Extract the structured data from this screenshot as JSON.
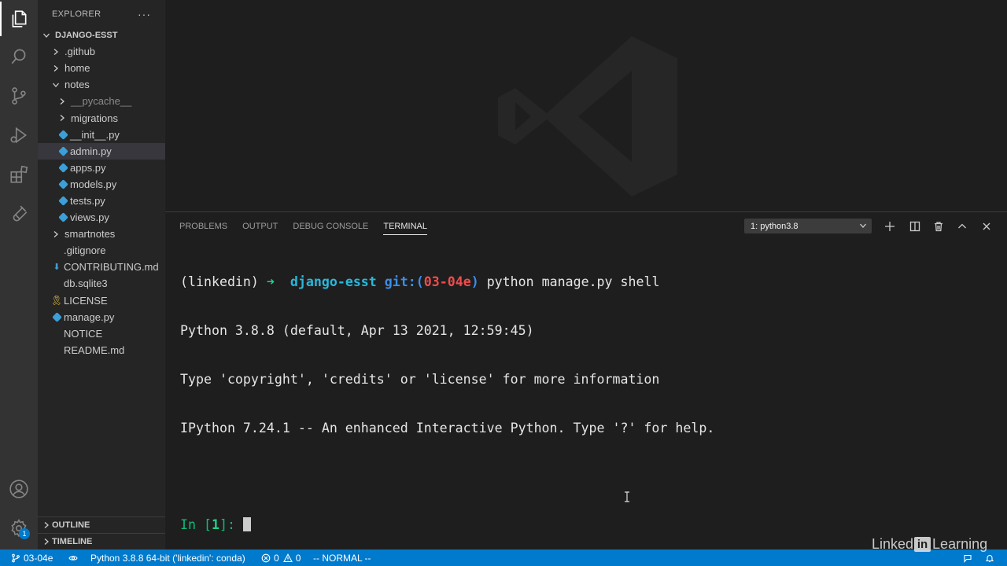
{
  "sidebar": {
    "title": "EXPLORER",
    "more": "···",
    "items": [
      {
        "label": "DJANGO-ESST",
        "kind": "root",
        "depth": 0,
        "chevron": "down"
      },
      {
        "label": ".github",
        "kind": "folder",
        "depth": 1,
        "chevron": "right"
      },
      {
        "label": "home",
        "kind": "folder",
        "depth": 1,
        "chevron": "right"
      },
      {
        "label": "notes",
        "kind": "folder",
        "depth": 1,
        "chevron": "down"
      },
      {
        "label": "__pycache__",
        "kind": "folder-dim",
        "depth": 2,
        "chevron": "right"
      },
      {
        "label": "migrations",
        "kind": "folder",
        "depth": 2,
        "chevron": "right"
      },
      {
        "label": "__init__.py",
        "kind": "python",
        "depth": 2
      },
      {
        "label": "admin.py",
        "kind": "python",
        "depth": 2,
        "selected": true
      },
      {
        "label": "apps.py",
        "kind": "python",
        "depth": 2
      },
      {
        "label": "models.py",
        "kind": "python",
        "depth": 2
      },
      {
        "label": "tests.py",
        "kind": "python",
        "depth": 2
      },
      {
        "label": "views.py",
        "kind": "python",
        "depth": 2
      },
      {
        "label": "smartnotes",
        "kind": "folder",
        "depth": 1,
        "chevron": "right"
      },
      {
        "label": ".gitignore",
        "kind": "plain",
        "depth": 1
      },
      {
        "label": "CONTRIBUTING.md",
        "kind": "markdown",
        "depth": 1
      },
      {
        "label": "db.sqlite3",
        "kind": "plain",
        "depth": 1
      },
      {
        "label": "LICENSE",
        "kind": "license",
        "depth": 1
      },
      {
        "label": "manage.py",
        "kind": "python",
        "depth": 1
      },
      {
        "label": "NOTICE",
        "kind": "plain",
        "depth": 1
      },
      {
        "label": "README.md",
        "kind": "plain",
        "depth": 1
      }
    ],
    "outline": "OUTLINE",
    "timeline": "TIMELINE"
  },
  "panel": {
    "tabs": [
      {
        "label": "PROBLEMS",
        "active": false
      },
      {
        "label": "OUTPUT",
        "active": false
      },
      {
        "label": "DEBUG CONSOLE",
        "active": false
      },
      {
        "label": "TERMINAL",
        "active": true
      }
    ],
    "terminal_select": "1: python3.8"
  },
  "terminal": {
    "prompt_env": "(linkedin) ",
    "prompt_arrow": "➜",
    "prompt_dir": "django-esst",
    "prompt_git": "git:(",
    "prompt_branch": "03-04e",
    "prompt_git_close": ")",
    "command": " python manage.py shell",
    "line2": "Python 3.8.8 (default, Apr 13 2021, 12:59:45)",
    "line3": "Type 'copyright', 'credits' or 'license' for more information",
    "line4": "IPython 7.24.1 -- An enhanced Interactive Python. Type '?' for help.",
    "in_prefix": "In [",
    "in_number": "1",
    "in_suffix": "]: "
  },
  "statusbar": {
    "branch": "03-04e",
    "python": "Python 3.8.8 64-bit ('linkedin': conda)",
    "errors": "0",
    "warnings": "0",
    "mode": "-- NORMAL --"
  },
  "activity": {
    "settings_badge": "1"
  },
  "brand": {
    "linked": "Linked",
    "in": "in",
    "learning": " Learning"
  },
  "colors": {
    "accent": "#007acc",
    "activity_bar": "#333333",
    "sidebar": "#252526",
    "editor": "#1e1e1e"
  }
}
